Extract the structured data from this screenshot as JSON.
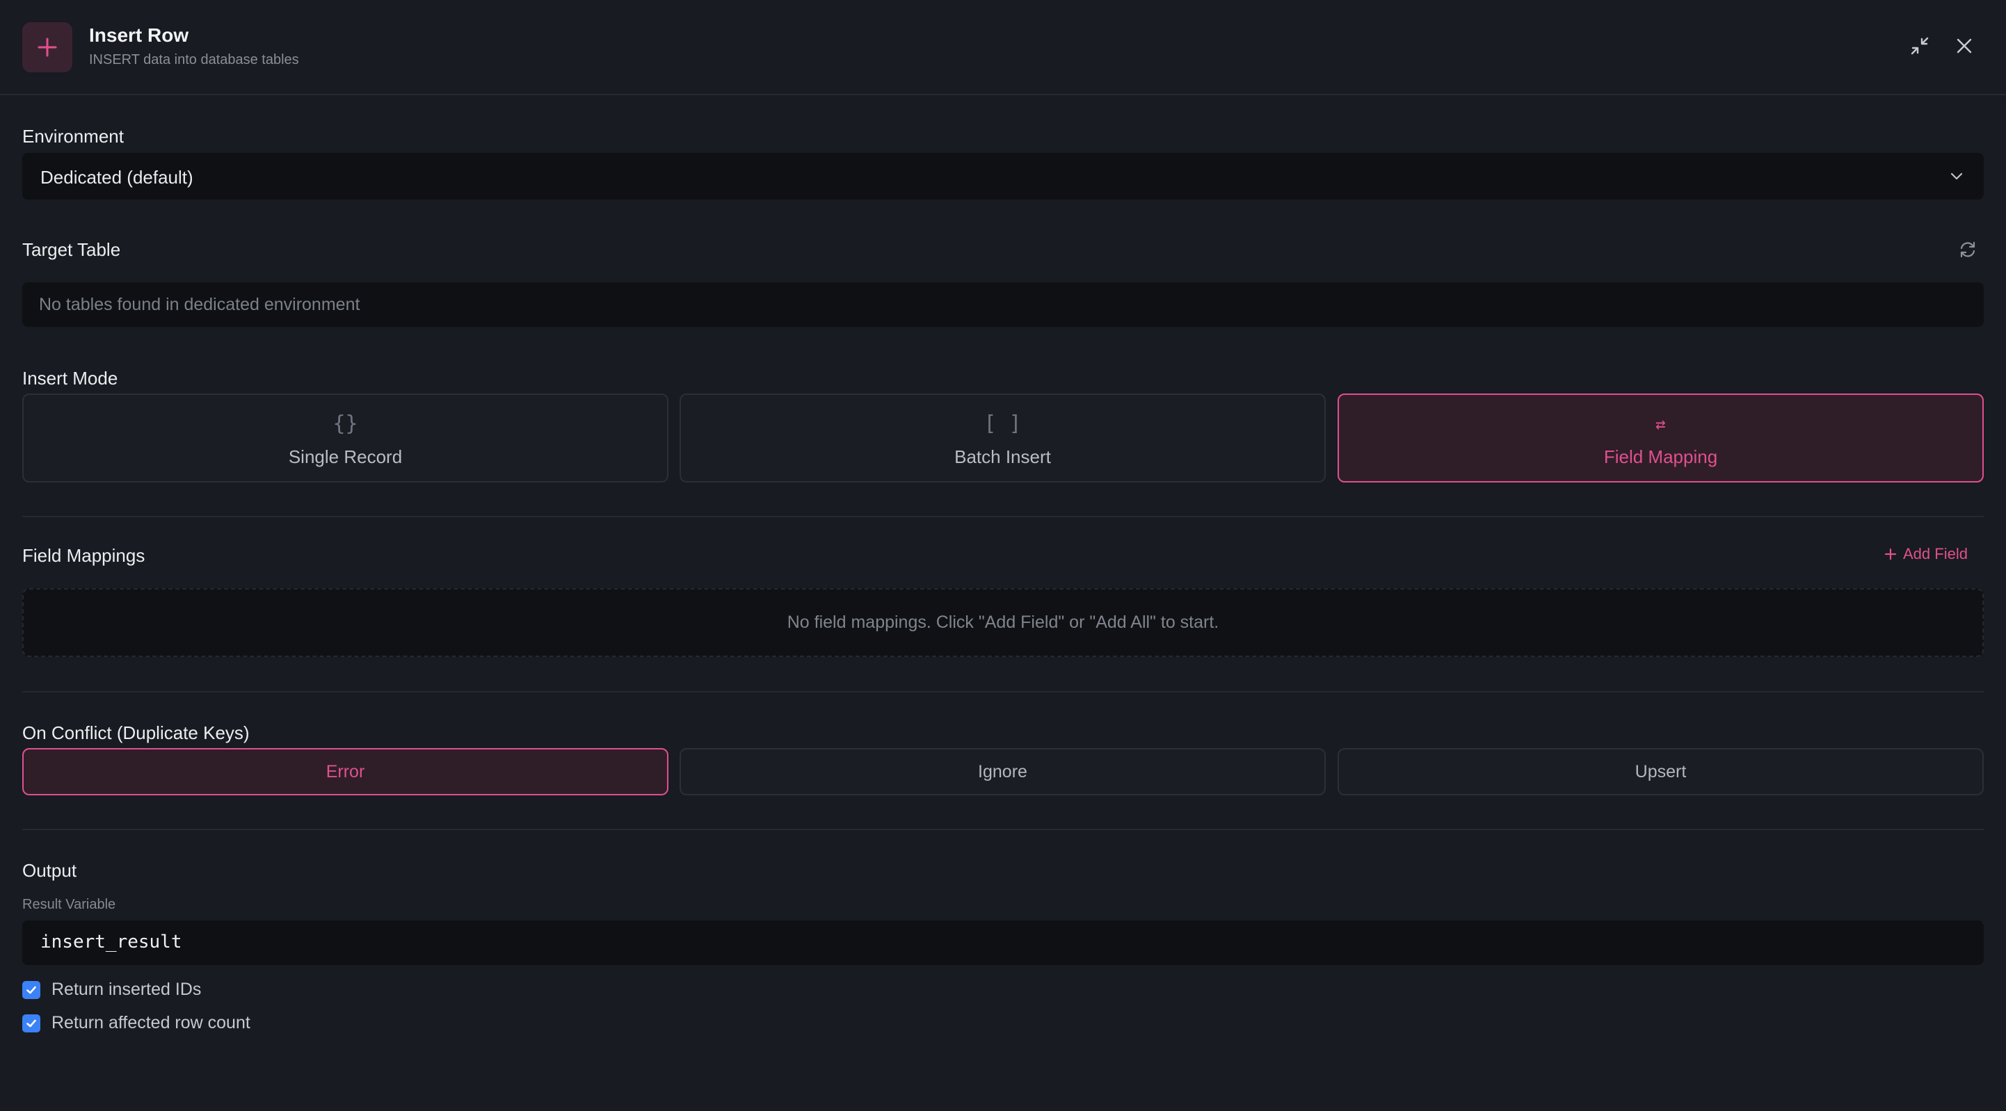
{
  "header": {
    "title": "Insert Row",
    "subtitle": "INSERT data into database tables",
    "accent": "#e0508f"
  },
  "environment": {
    "label": "Environment",
    "value": "Dedicated (default)"
  },
  "target_table": {
    "label": "Target Table",
    "placeholder": "No tables found in dedicated environment"
  },
  "insert_mode": {
    "label": "Insert Mode",
    "options": [
      {
        "glyph": "{}",
        "label": "Single Record",
        "selected": false
      },
      {
        "glyph": "[ ]",
        "label": "Batch Insert",
        "selected": false
      },
      {
        "glyph": "⇄",
        "label": "Field Mapping",
        "selected": true
      }
    ]
  },
  "field_mappings": {
    "label": "Field Mappings",
    "add_label": "Add Field",
    "empty_text": "No field mappings. Click \"Add Field\" or \"Add All\" to start."
  },
  "on_conflict": {
    "label": "On Conflict (Duplicate Keys)",
    "options": [
      {
        "label": "Error",
        "selected": true
      },
      {
        "label": "Ignore",
        "selected": false
      },
      {
        "label": "Upsert",
        "selected": false
      }
    ]
  },
  "output": {
    "label": "Output",
    "result_variable_label": "Result Variable",
    "result_variable_value": "insert_result",
    "checkboxes": [
      {
        "label": "Return inserted IDs",
        "checked": true
      },
      {
        "label": "Return affected row count",
        "checked": true
      }
    ]
  }
}
